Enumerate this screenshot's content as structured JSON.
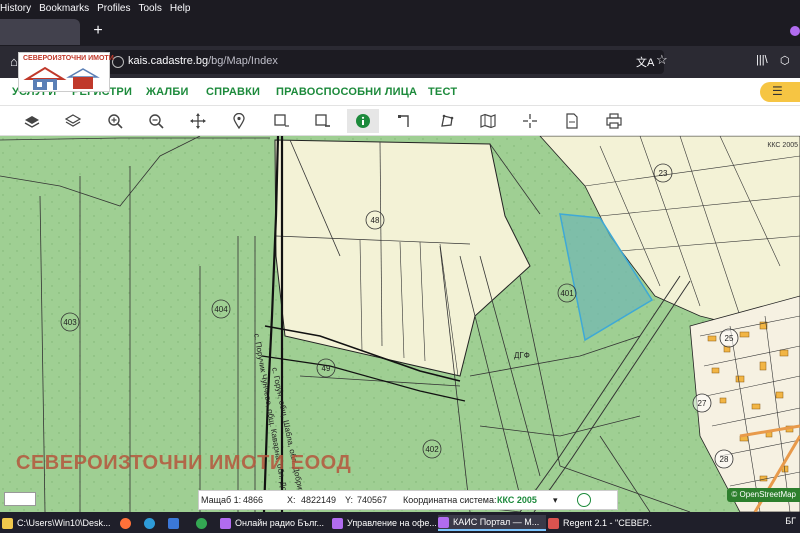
{
  "browser": {
    "menu": [
      "History",
      "Bookmarks",
      "Profiles",
      "Tools",
      "Help"
    ],
    "newtab_symbol": "+",
    "url_host": "kais.cadastre.bg",
    "url_path": "/bg/Map/Index"
  },
  "logo": {
    "text": "СЕВЕРОИЗТОЧНИ ИМОТИ",
    "accent_color": "#c0392b"
  },
  "site_menu": {
    "items": [
      "УСЛУГИ",
      "РЕГИСТРИ",
      "ЖАЛБИ",
      "СПРАВКИ",
      "ПРАВОСПОСОБНИ ЛИЦА",
      "ТЕСТ"
    ],
    "accent_color": "#1c8a3b"
  },
  "toolbar": {
    "tools": [
      "layers-icon",
      "stack-icon",
      "zoom-in-icon",
      "zoom-out-icon",
      "pan-icon",
      "pin-icon",
      "select-add-icon",
      "select-remove-icon",
      "info-icon",
      "measure-line-icon",
      "measure-area-icon",
      "map-icon",
      "crosshair-icon",
      "document-icon",
      "print-icon"
    ],
    "active_tool": "info-icon"
  },
  "map": {
    "parcel_numbers": [
      "23",
      "48",
      "401",
      "403",
      "404",
      "49",
      "402",
      "25",
      "27",
      "28"
    ],
    "road_label_1": "с. Горун, общ. Шабла, обл. Добрич",
    "road_label_2": "с. Поручик Чунчево, общ. Каварна, обл. Добрич",
    "dgf_label": "ДГФ",
    "watermark": "СЕВЕРОИЗТОЧНИ ИМОТИ ЕООД",
    "kks_corner": "ККС 2005",
    "attribution": "© OpenStreetMap",
    "selected_parcel": "401"
  },
  "statusbar": {
    "scale_label": "Мащаб 1:",
    "scale_value": "4866",
    "x_label": "X:",
    "x_value": "4822149",
    "y_label": "Y:",
    "y_value": "740567",
    "crs_label": "Координатна система:",
    "crs_value": "ККС 2005"
  },
  "taskbar": {
    "items": [
      "C:\\Users\\Win10\\Desk...",
      "Онлайн радио Бълг...",
      "Управление на офе...",
      "КАИС Портал — M...",
      "Regent 2.1 - \"СЕВЕР..."
    ],
    "tray_text": "БГ"
  }
}
